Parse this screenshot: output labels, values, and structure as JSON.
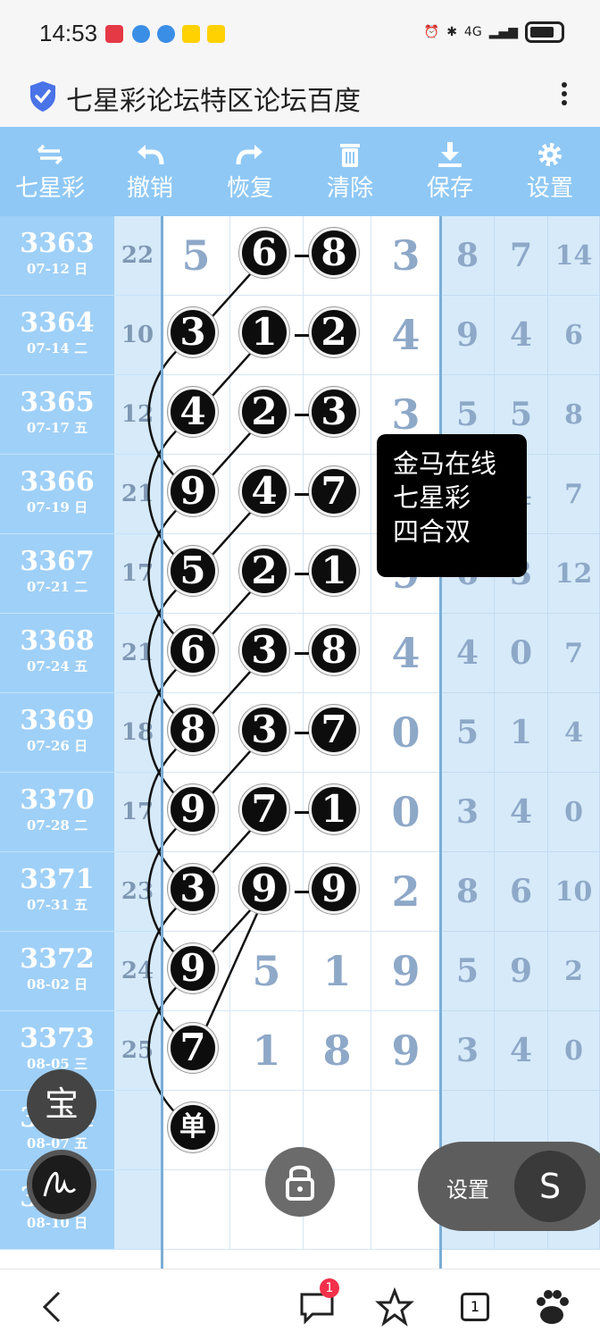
{
  "status": {
    "time": "14:53",
    "network": "4G"
  },
  "browser": {
    "title": "七星彩论坛特区论坛百度"
  },
  "toolbar": [
    {
      "label": "七星彩",
      "icon": "swap-icon"
    },
    {
      "label": "撤销",
      "icon": "undo-icon"
    },
    {
      "label": "恢复",
      "icon": "redo-icon"
    },
    {
      "label": "清除",
      "icon": "trash-icon"
    },
    {
      "label": "保存",
      "icon": "download-icon"
    },
    {
      "label": "设置",
      "icon": "gear-icon"
    }
  ],
  "rows": [
    {
      "issue": "3363",
      "date": "07-12 日",
      "sum": "22",
      "d": [
        "5",
        "6",
        "8",
        "3"
      ],
      "r": [
        "8",
        "7",
        "14"
      ]
    },
    {
      "issue": "3364",
      "date": "07-14 二",
      "sum": "10",
      "d": [
        "3",
        "1",
        "2",
        "4"
      ],
      "r": [
        "9",
        "4",
        "6"
      ]
    },
    {
      "issue": "3365",
      "date": "07-17 五",
      "sum": "12",
      "d": [
        "4",
        "2",
        "3",
        "3"
      ],
      "r": [
        "5",
        "5",
        "8"
      ]
    },
    {
      "issue": "3366",
      "date": "07-19 日",
      "sum": "21",
      "d": [
        "9",
        "4",
        "7",
        ""
      ],
      "r": [
        "",
        "4",
        "7"
      ]
    },
    {
      "issue": "3367",
      "date": "07-21 二",
      "sum": "17",
      "d": [
        "5",
        "2",
        "1",
        "9"
      ],
      "r": [
        "6",
        "3",
        "12"
      ]
    },
    {
      "issue": "3368",
      "date": "07-24 五",
      "sum": "21",
      "d": [
        "6",
        "3",
        "8",
        "4"
      ],
      "r": [
        "4",
        "0",
        "7"
      ]
    },
    {
      "issue": "3369",
      "date": "07-26 日",
      "sum": "18",
      "d": [
        "8",
        "3",
        "7",
        "0"
      ],
      "r": [
        "5",
        "1",
        "4"
      ]
    },
    {
      "issue": "3370",
      "date": "07-28 二",
      "sum": "17",
      "d": [
        "9",
        "7",
        "1",
        "0"
      ],
      "r": [
        "3",
        "4",
        "0"
      ]
    },
    {
      "issue": "3371",
      "date": "07-31 五",
      "sum": "23",
      "d": [
        "3",
        "9",
        "9",
        "2"
      ],
      "r": [
        "8",
        "6",
        "10"
      ]
    },
    {
      "issue": "3372",
      "date": "08-02 日",
      "sum": "24",
      "d": [
        "9",
        "5",
        "1",
        "9"
      ],
      "r": [
        "5",
        "9",
        "2"
      ]
    },
    {
      "issue": "3373",
      "date": "08-05 三",
      "sum": "25",
      "d": [
        "7",
        "1",
        "8",
        "9"
      ],
      "r": [
        "3",
        "4",
        "0"
      ]
    },
    {
      "issue": "3374",
      "date": "08-07 五",
      "sum": "",
      "d": [
        "单",
        "",
        "",
        ""
      ],
      "r": [
        "",
        "",
        ""
      ]
    },
    {
      "issue": "3375",
      "date": "08-10 日",
      "sum": "",
      "d": [
        "",
        "",
        "",
        ""
      ],
      "r": [
        "",
        "",
        ""
      ]
    }
  ],
  "tooltip": {
    "line1": "金马在线",
    "line2": "七星彩",
    "line3": "四合双"
  },
  "floating": {
    "bao": "宝",
    "settings_label": "设置",
    "s_label": "S"
  },
  "bottomnav": {
    "badge": "1",
    "tabs_count": "1"
  }
}
